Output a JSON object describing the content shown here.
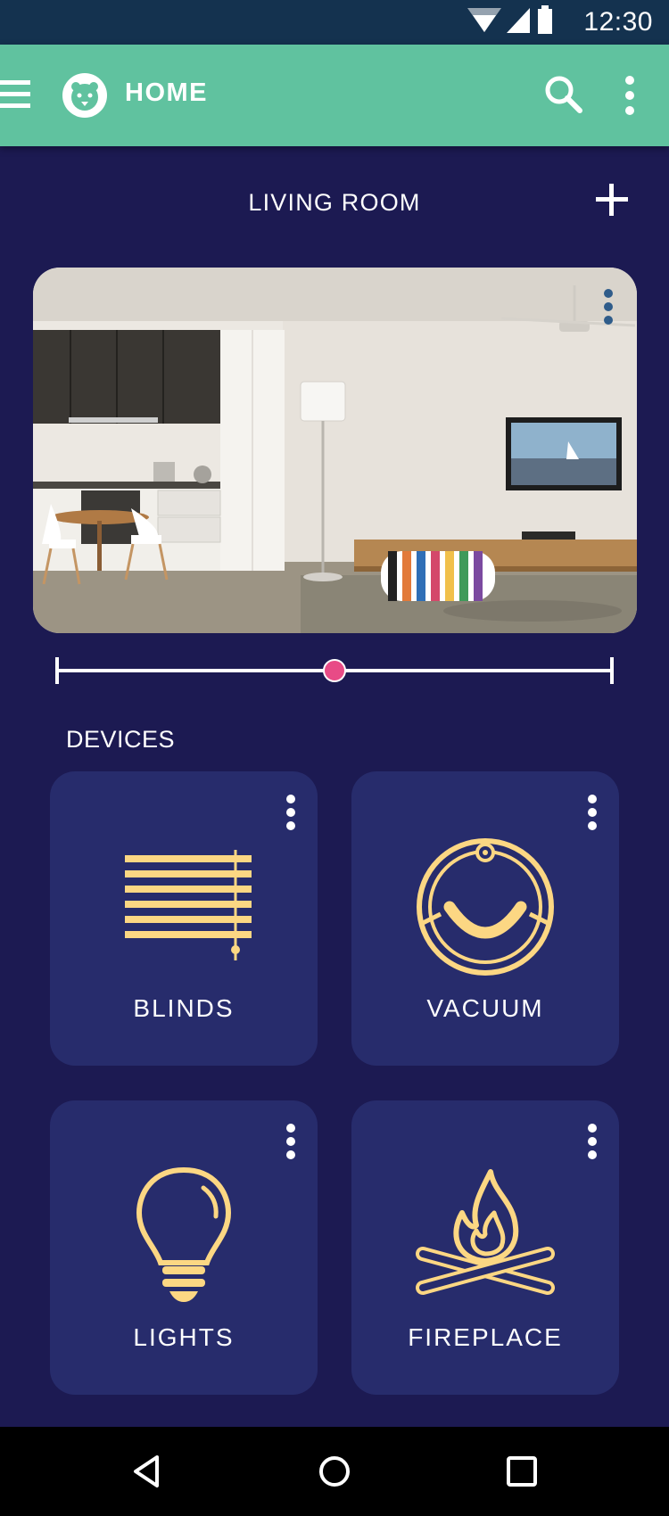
{
  "status_bar": {
    "time": "12:30",
    "icons": [
      "wifi-icon",
      "cell-signal-icon",
      "battery-icon"
    ]
  },
  "app_bar": {
    "title": "HOME",
    "icons": [
      "menu-icon",
      "lion-logo-icon",
      "search-icon",
      "more-vert-icon"
    ]
  },
  "room": {
    "title": "LIVING ROOM",
    "add_icon": "plus-icon",
    "photo_alt": "living-room-photo",
    "slider_value_percent": 50
  },
  "devices": {
    "label": "DEVICES",
    "items": [
      {
        "label": "BLINDS",
        "icon": "blinds-icon"
      },
      {
        "label": "VACUUM",
        "icon": "robot-vacuum-icon"
      },
      {
        "label": "LIGHTS",
        "icon": "lightbulb-icon"
      },
      {
        "label": "FIREPLACE",
        "icon": "campfire-icon"
      }
    ]
  },
  "nav_bar": {
    "icons": [
      "back-icon",
      "home-circle-icon",
      "recents-square-icon"
    ]
  },
  "colors": {
    "background": "#1c1a52",
    "status_bar": "#14324f",
    "app_bar": "#60c29f",
    "card": "#272c6c",
    "icon_accent": "#fcd783",
    "slider_thumb": "#e84b86"
  }
}
